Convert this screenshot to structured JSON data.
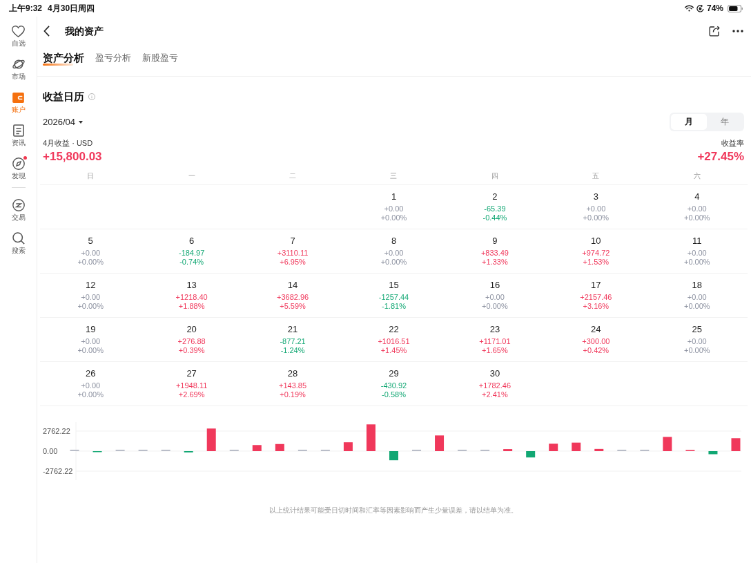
{
  "status_bar": {
    "time": "上午9:32",
    "date": "4月30日周四",
    "battery": "74%"
  },
  "sidebar": {
    "nav_items": [
      {
        "label": "自选",
        "selected": false,
        "notification": false
      },
      {
        "label": "市场",
        "selected": false,
        "notification": false
      },
      {
        "label": "账户",
        "selected": true,
        "notification": false
      },
      {
        "label": "资讯",
        "selected": false,
        "notification": false
      },
      {
        "label": "发现",
        "selected": false,
        "notification": true
      }
    ],
    "tool_items": [
      {
        "label": "交易",
        "selected": false,
        "notification": false
      },
      {
        "label": "搜索",
        "selected": false,
        "notification": false
      }
    ]
  },
  "header": {
    "title": "我的资产"
  },
  "tabs": [
    {
      "label": "资产分析",
      "selected": true
    },
    {
      "label": "盈亏分析",
      "selected": false
    },
    {
      "label": "新股盈亏",
      "selected": false
    }
  ],
  "income_calendar": {
    "title": "收益日历",
    "month": "2026/04",
    "period_toggle": [
      {
        "label": "月",
        "selected": true
      },
      {
        "label": "年",
        "selected": false
      }
    ],
    "income_label": "4月收益 · USD",
    "income_value": "+15,800.03",
    "rate_label": "收益率",
    "rate_value": "+27.45%",
    "weekdays": [
      "日",
      "一",
      "二",
      "三",
      "四",
      "五",
      "六"
    ],
    "weeks": [
      [
        {
          "kind": "blank"
        },
        {
          "kind": "blank"
        },
        {
          "kind": "blank"
        },
        {
          "kind": "day",
          "date": "1",
          "profit": "+0.00",
          "return": "+0.00%",
          "color": "#8c91a0"
        },
        {
          "kind": "day",
          "date": "2",
          "profit": "-65.39",
          "return": "-0.44%",
          "color": "#11a773"
        },
        {
          "kind": "day",
          "date": "3",
          "profit": "+0.00",
          "return": "+0.00%",
          "color": "#8c91a0"
        },
        {
          "kind": "day",
          "date": "4",
          "profit": "+0.00",
          "return": "+0.00%",
          "color": "#8c91a0"
        }
      ],
      [
        {
          "kind": "day",
          "date": "5",
          "profit": "+0.00",
          "return": "+0.00%",
          "color": "#8c91a0"
        },
        {
          "kind": "day",
          "date": "6",
          "profit": "-184.97",
          "return": "-0.74%",
          "color": "#11a773"
        },
        {
          "kind": "day",
          "date": "7",
          "profit": "+3110.11",
          "return": "+6.95%",
          "color": "#f0385b"
        },
        {
          "kind": "day",
          "date": "8",
          "profit": "+0.00",
          "return": "+0.00%",
          "color": "#8c91a0"
        },
        {
          "kind": "day",
          "date": "9",
          "profit": "+833.49",
          "return": "+1.33%",
          "color": "#f0385b"
        },
        {
          "kind": "day",
          "date": "10",
          "profit": "+974.72",
          "return": "+1.53%",
          "color": "#f0385b"
        },
        {
          "kind": "day",
          "date": "11",
          "profit": "+0.00",
          "return": "+0.00%",
          "color": "#8c91a0"
        }
      ],
      [
        {
          "kind": "day",
          "date": "12",
          "profit": "+0.00",
          "return": "+0.00%",
          "color": "#8c91a0"
        },
        {
          "kind": "day",
          "date": "13",
          "profit": "+1218.40",
          "return": "+1.88%",
          "color": "#f0385b"
        },
        {
          "kind": "day",
          "date": "14",
          "profit": "+3682.96",
          "return": "+5.59%",
          "color": "#f0385b"
        },
        {
          "kind": "day",
          "date": "15",
          "profit": "-1257.44",
          "return": "-1.81%",
          "color": "#11a773"
        },
        {
          "kind": "day",
          "date": "16",
          "profit": "+0.00",
          "return": "+0.00%",
          "color": "#8c91a0"
        },
        {
          "kind": "day",
          "date": "17",
          "profit": "+2157.46",
          "return": "+3.16%",
          "color": "#f0385b"
        },
        {
          "kind": "day",
          "date": "18",
          "profit": "+0.00",
          "return": "+0.00%",
          "color": "#8c91a0"
        }
      ],
      [
        {
          "kind": "day",
          "date": "19",
          "profit": "+0.00",
          "return": "+0.00%",
          "color": "#8c91a0"
        },
        {
          "kind": "day",
          "date": "20",
          "profit": "+276.88",
          "return": "+0.39%",
          "color": "#f0385b"
        },
        {
          "kind": "day",
          "date": "21",
          "profit": "-877.21",
          "return": "-1.24%",
          "color": "#11a773"
        },
        {
          "kind": "day",
          "date": "22",
          "profit": "+1016.51",
          "return": "+1.45%",
          "color": "#f0385b"
        },
        {
          "kind": "day",
          "date": "23",
          "profit": "+1171.01",
          "return": "+1.65%",
          "color": "#f0385b"
        },
        {
          "kind": "day",
          "date": "24",
          "profit": "+300.00",
          "return": "+0.42%",
          "color": "#f0385b"
        },
        {
          "kind": "day",
          "date": "25",
          "profit": "+0.00",
          "return": "+0.00%",
          "color": "#8c91a0"
        }
      ],
      [
        {
          "kind": "day",
          "date": "26",
          "profit": "+0.00",
          "return": "+0.00%",
          "color": "#8c91a0"
        },
        {
          "kind": "day",
          "date": "27",
          "profit": "+1948.11",
          "return": "+2.69%",
          "color": "#f0385b"
        },
        {
          "kind": "day",
          "date": "28",
          "profit": "+143.85",
          "return": "+0.19%",
          "color": "#f0385b"
        },
        {
          "kind": "day",
          "date": "29",
          "profit": "-430.92",
          "return": "-0.58%",
          "color": "#11a773"
        },
        {
          "kind": "day",
          "date": "30",
          "profit": "+1782.46",
          "return": "+2.41%",
          "color": "#f0385b"
        }
      ]
    ],
    "chart": {
      "chart_data": {
        "type": "bar",
        "grid": true,
        "ylim": [
          -4000,
          4000
        ],
        "yticks": [
          {
            "value": 2762.22,
            "label": "2762.22"
          },
          {
            "value": 0,
            "label": "0.00"
          },
          {
            "value": -2762.22,
            "label": "-2762.22"
          }
        ],
        "values": [
          0,
          -65.39,
          0,
          0,
          0,
          -184.97,
          3110.11,
          0,
          833.49,
          974.72,
          0,
          0,
          1218.4,
          3682.96,
          -1257.44,
          0,
          2157.46,
          0,
          0,
          276.88,
          -877.21,
          1016.51,
          1171.01,
          300.0,
          0,
          0,
          1948.11,
          143.85,
          -430.92,
          1782.46
        ]
      }
    },
    "note": "以上统计结果可能受日切时间和汇率等因素影响而产生少量误差，请以结单为准。"
  }
}
